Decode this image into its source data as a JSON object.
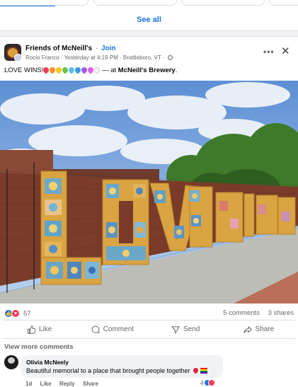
{
  "feed_top": {
    "see_all_label": "See all"
  },
  "post": {
    "group_name": "Friends of McNeill's",
    "separator": "·",
    "join_label": "Join",
    "author": "Rocio Franco",
    "timestamp": "Yesterday at 4:19 PM",
    "location": "Brattleboro, VT",
    "more_icon": "more-dots-icon",
    "close_icon": "close-icon",
    "text_prefix": "LOVE WINS!",
    "text_middle": " — at ",
    "place": "McNeill's Brewery",
    "text_suffix": ".",
    "heart_colors": [
      "#f33e58",
      "#f7931e",
      "#f7c51e",
      "#6cc24a",
      "#5bc0eb",
      "#3b9ae1",
      "#a259e6",
      "#e05ce3",
      "#f2f2f2"
    ],
    "photo_description_colors": {
      "sky": "#9fc6ec",
      "brick": "#7a3b2a",
      "crochet": "#d9a441",
      "trees": "#3f7a2a",
      "pavement": "#bdbdb8"
    },
    "reaction_count": "57",
    "comments_count": "5 comments",
    "shares_count": "3 shares",
    "actions": {
      "like": "Like",
      "comment": "Comment",
      "send": "Send",
      "share": "Share"
    }
  },
  "comments": {
    "view_more": "View more comments",
    "items": [
      {
        "name": "Olivia McNeely",
        "text": "Beautiful memorial to a place that brought people together",
        "age": "1d",
        "like_label": "Like",
        "reply_label": "Reply",
        "share_label": "Share",
        "reaction_count": "4"
      }
    ]
  },
  "colors": {
    "accent": "#1b74e4",
    "secondary_text": "#65676b",
    "divider": "#dadde1"
  }
}
